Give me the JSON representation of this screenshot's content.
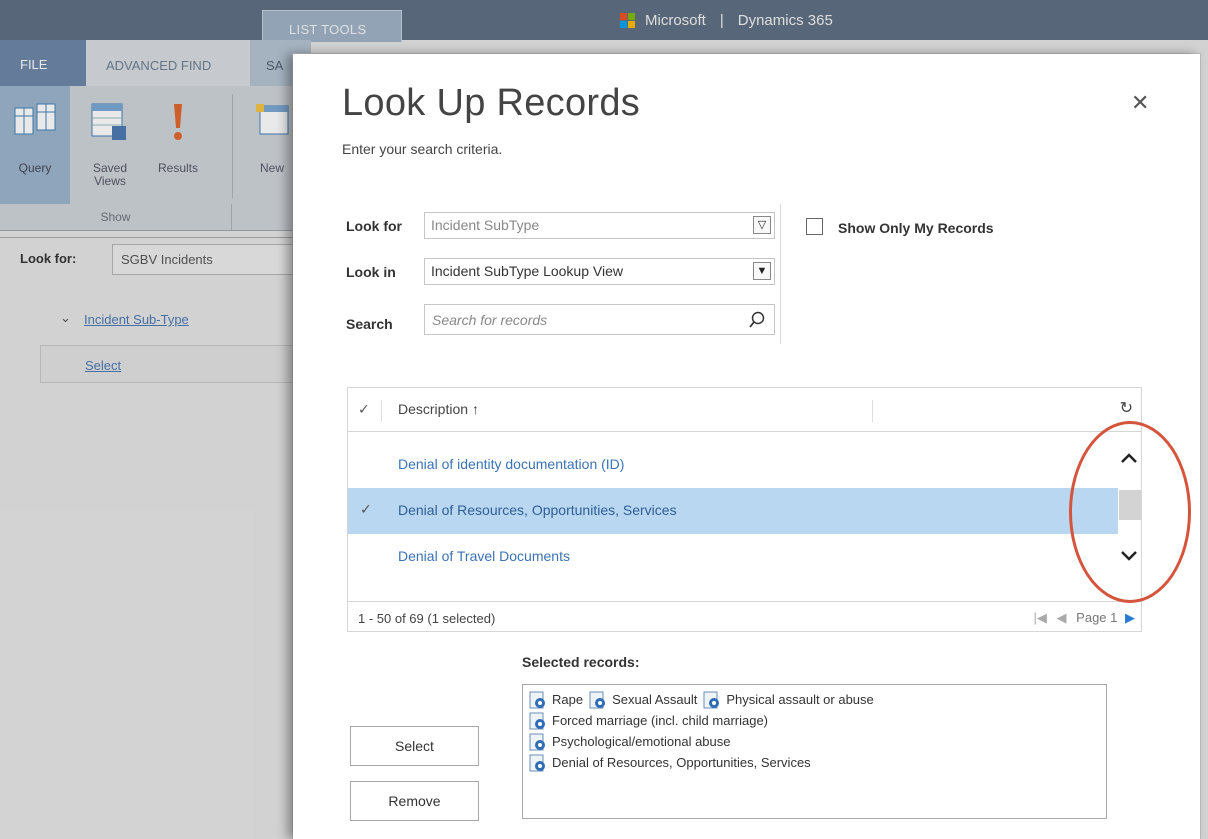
{
  "app": {
    "brand_ms": "Microsoft",
    "brand_sep": "|",
    "brand_product": "Dynamics 365",
    "contextual_tab": "LIST TOOLS"
  },
  "ribbon": {
    "tabs": [
      "FILE",
      "ADVANCED FIND",
      "SA"
    ],
    "buttons": {
      "query": "Query",
      "saved_views": "Saved Views",
      "results": "Results",
      "new": "New"
    },
    "group_label": "Show"
  },
  "background": {
    "look_for_label": "Look for:",
    "look_for_value": "SGBV Incidents",
    "condition_group": "Incident Sub-Type",
    "select_link": "Select"
  },
  "dialog": {
    "title": "Look Up Records",
    "subtitle": "Enter your search criteria.",
    "close_glyph": "✕",
    "look_for": {
      "label": "Look for",
      "value": "Incident SubType"
    },
    "look_in": {
      "label": "Look in",
      "value": "Incident SubType Lookup View"
    },
    "search": {
      "label": "Search",
      "placeholder": "Search for records"
    },
    "show_only_mine": {
      "label": "Show Only My Records",
      "checked": false
    },
    "grid": {
      "column": "Description",
      "sort_glyph": "↑",
      "rows": [
        {
          "text": "Denial of identity documentation (ID)",
          "selected": false
        },
        {
          "text": "Denial of Resources, Opportunities, Services",
          "selected": true
        },
        {
          "text": "Denial of Travel Documents",
          "selected": false
        }
      ],
      "footer_count": "1 - 50 of 69 (1 selected)",
      "page_label": "Page 1"
    },
    "selected_records": {
      "label": "Selected records:",
      "lines": [
        [
          "Rape",
          "Sexual Assault",
          "Physical assault or abuse"
        ],
        [
          "Forced marriage (incl. child marriage)"
        ],
        [
          "Psychological/emotional abuse"
        ],
        [
          "Denial of Resources, Opportunities, Services"
        ]
      ]
    },
    "buttons": {
      "select": "Select",
      "remove": "Remove"
    }
  },
  "colors": {
    "accent": "#2b7cd3",
    "row_selected": "#b9d7f0",
    "annotation": "#d4553c"
  }
}
